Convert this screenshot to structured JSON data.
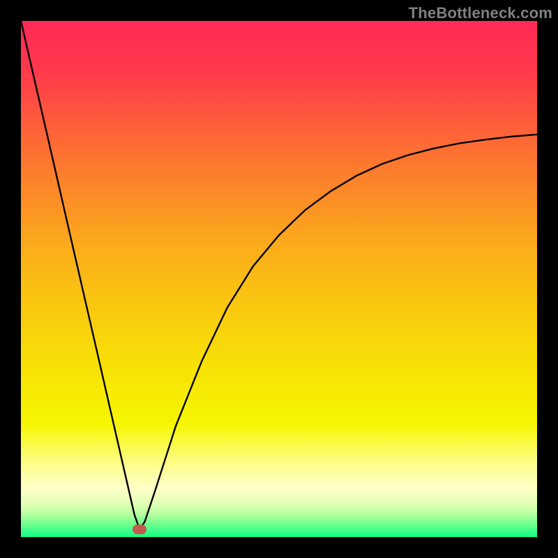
{
  "watermark": "TheBottleneck.com",
  "colors": {
    "frame_bg": "#000000",
    "curve": "#000000",
    "marker": "#c25b4e"
  },
  "gradient_stops": [
    {
      "offset": 0.0,
      "color": "#ff2957"
    },
    {
      "offset": 0.1,
      "color": "#ff3a4b"
    },
    {
      "offset": 0.25,
      "color": "#fd6f32"
    },
    {
      "offset": 0.45,
      "color": "#fbb019"
    },
    {
      "offset": 0.62,
      "color": "#f8d709"
    },
    {
      "offset": 0.78,
      "color": "#f6f601"
    },
    {
      "offset": 0.86,
      "color": "#fdfe8d"
    },
    {
      "offset": 0.905,
      "color": "#ffffc8"
    },
    {
      "offset": 0.935,
      "color": "#e2ffb6"
    },
    {
      "offset": 0.955,
      "color": "#b7ff9f"
    },
    {
      "offset": 0.975,
      "color": "#6eff8e"
    },
    {
      "offset": 1.0,
      "color": "#10ff87"
    }
  ],
  "chart_data": {
    "type": "line",
    "title": "",
    "xlabel": "",
    "ylabel": "",
    "xlim": [
      0,
      100
    ],
    "ylim": [
      0,
      100
    ],
    "optimum_x": 23,
    "max_x_shown": 100,
    "y_at_max_x": 78,
    "marker": {
      "x": 23,
      "y": 1.5
    },
    "series": [
      {
        "name": "bottleneck",
        "x": [
          0,
          5,
          10,
          15,
          20,
          22,
          23,
          24,
          26,
          30,
          35,
          40,
          45,
          50,
          55,
          60,
          65,
          70,
          75,
          80,
          85,
          90,
          95,
          100
        ],
        "values": [
          100,
          78.3,
          56.5,
          34.8,
          13.0,
          4.3,
          1.5,
          3.0,
          9.0,
          21.5,
          34.0,
          44.5,
          52.5,
          58.5,
          63.3,
          67.0,
          70.0,
          72.3,
          74.0,
          75.3,
          76.3,
          77.0,
          77.6,
          78.0
        ]
      }
    ]
  }
}
